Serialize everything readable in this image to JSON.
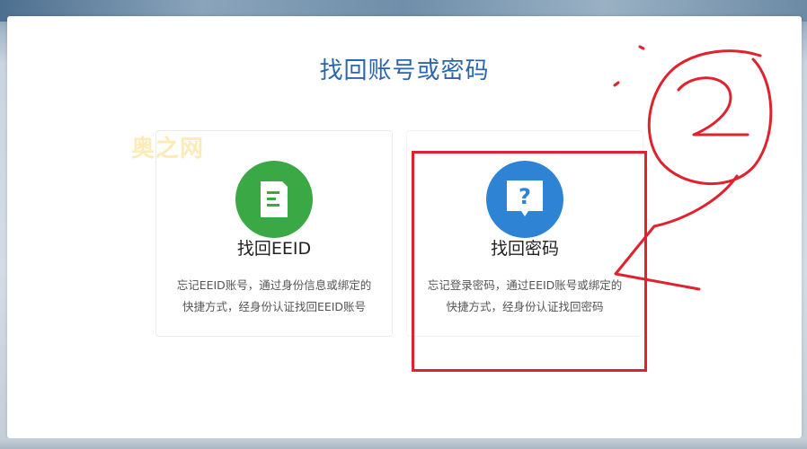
{
  "page": {
    "title": "找回账号或密码",
    "watermark": "奥之网"
  },
  "cards": [
    {
      "title": "找回EEID",
      "desc_line1": "忘记EEID账号，通过身份信息或绑定的",
      "desc_line2": "快捷方式，经身份认证找回EEID账号",
      "icon": "document-icon",
      "color": "#3aa845"
    },
    {
      "title": "找回密码",
      "desc_line1": "忘记登录密码，通过EEID账号或绑定的",
      "desc_line2": "快捷方式，经身份认证找回密码",
      "icon": "question-bubble-icon",
      "color": "#2f83d4"
    }
  ],
  "annotation": {
    "color": "#e0222e"
  }
}
